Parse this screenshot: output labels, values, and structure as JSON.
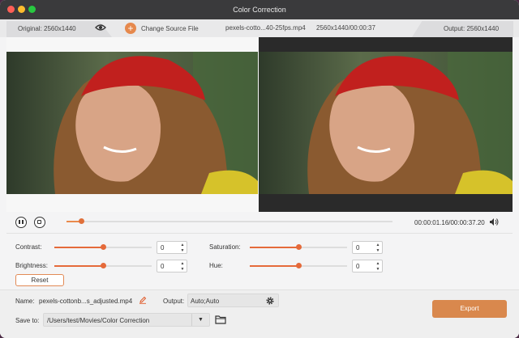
{
  "window": {
    "title": "Color Correction"
  },
  "infobar": {
    "original_label": "Original: 2560x1440",
    "change_source_label": "Change Source File",
    "file_name": "pexels-cotto...40-25fps.mp4",
    "file_resolution_duration": "2560x1440/00:00:37",
    "output_label": "Output: 2560x1440"
  },
  "playback": {
    "time": "00:00:01.16/00:00:37.20",
    "progress_fraction": 0.045
  },
  "params": {
    "contrast": {
      "label": "Contrast:",
      "value": "0",
      "slider_fraction": 0.5
    },
    "brightness": {
      "label": "Brightness:",
      "value": "0",
      "slider_fraction": 0.5
    },
    "saturation": {
      "label": "Saturation:",
      "value": "0",
      "slider_fraction": 0.5
    },
    "hue": {
      "label": "Hue:",
      "value": "0",
      "slider_fraction": 0.5
    },
    "reset_label": "Reset"
  },
  "output_settings": {
    "name_label": "Name:",
    "name_value": "pexels-cottonb...s_adjusted.mp4",
    "output_label": "Output:",
    "output_value": "Auto;Auto",
    "save_to_label": "Save to:",
    "save_to_value": "/Users/test/Movies/Color Correction",
    "export_label": "Export"
  },
  "colors": {
    "accent": "#e56a3a",
    "export_button": "#d9884d",
    "titlebar": "#3a3a3c"
  }
}
